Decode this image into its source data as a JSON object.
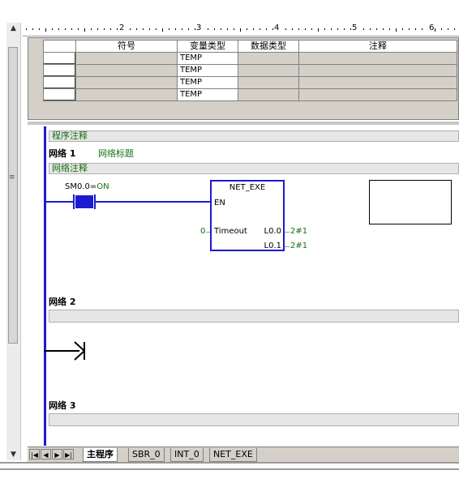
{
  "ruler": {
    "numbers": [
      "2",
      "3",
      "4",
      "5",
      "6"
    ]
  },
  "var_table": {
    "headers": {
      "symbol": "符号",
      "var_type": "变量类型",
      "data_type": "数据类型",
      "comment": "注释"
    },
    "rows": [
      {
        "var_type": "TEMP"
      },
      {
        "var_type": "TEMP"
      },
      {
        "var_type": "TEMP"
      },
      {
        "var_type": "TEMP"
      }
    ]
  },
  "program": {
    "program_comment": "程序注释",
    "network1": {
      "label": "网络 1",
      "title": "网络标题",
      "comment": "网络注释",
      "contact": {
        "address": "SM0.0",
        "sep": "=",
        "state": "ON"
      },
      "block": {
        "name": "NET_EXE",
        "en": "EN",
        "timeout_pin": "Timeout",
        "timeout_value": "0",
        "out1_pin": "L0.0",
        "out1_value": "2#1",
        "out2_pin": "L0.1",
        "out2_value": "2#1"
      }
    },
    "network2": {
      "label": "网络 2"
    },
    "network3": {
      "label": "网络 3"
    }
  },
  "tabs": {
    "items": [
      "主程序",
      "SBR_0",
      "INT_0",
      "NET_EXE"
    ],
    "active": 0
  },
  "colors": {
    "ladder_blue": "#1b1bd1",
    "comment_green": "#157015"
  },
  "icons": {
    "scroll_up": "triangle-up-icon",
    "scroll_down": "triangle-down-icon"
  }
}
